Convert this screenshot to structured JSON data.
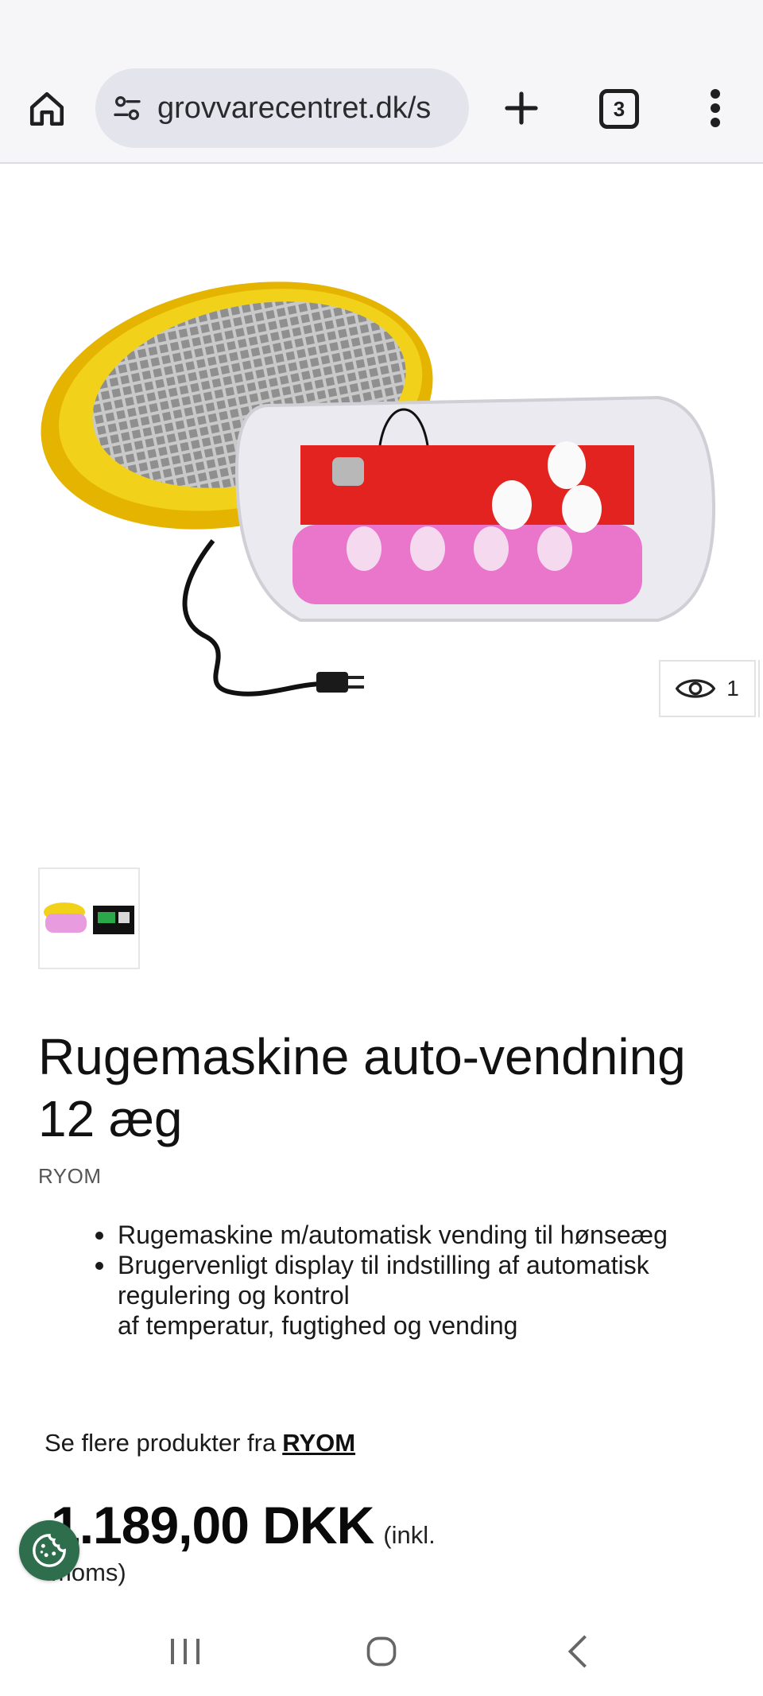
{
  "browser": {
    "url": "grovvarecentret.dk/s",
    "tab_count": "3",
    "icons": {
      "home": "home-icon",
      "site_settings": "tune-icon",
      "new_tab": "plus-icon",
      "menu": "more-vertical-icon"
    }
  },
  "product": {
    "image_alt": "Rugemaskine auto-vendning 12 æg",
    "view_count": "1",
    "title": "Rugemaskine auto-vendning 12 æg",
    "brand": "RYOM",
    "features": [
      "Rugemaskine m/automatisk vending til hønseæg",
      "Brugervenligt display til indstilling af automatisk\nregulering og kontrol\naf temperatur, fugtighed og vending"
    ],
    "more_products_prefix": "Se flere produkter fra",
    "more_products_link": "RYOM",
    "price": "1.189,00 DKK",
    "price_note_1": "(inkl.",
    "price_note_2": "moms)"
  },
  "colors": {
    "browser_bg": "#f6f6f9",
    "url_pill": "#e4e4ec",
    "cookie_button": "#2f6e4c",
    "incubator_lid": "#f2d11b",
    "egg_tray": "#e3231f"
  },
  "system_nav": {
    "recents": "recents-icon",
    "home": "circle-home-icon",
    "back": "back-icon"
  }
}
